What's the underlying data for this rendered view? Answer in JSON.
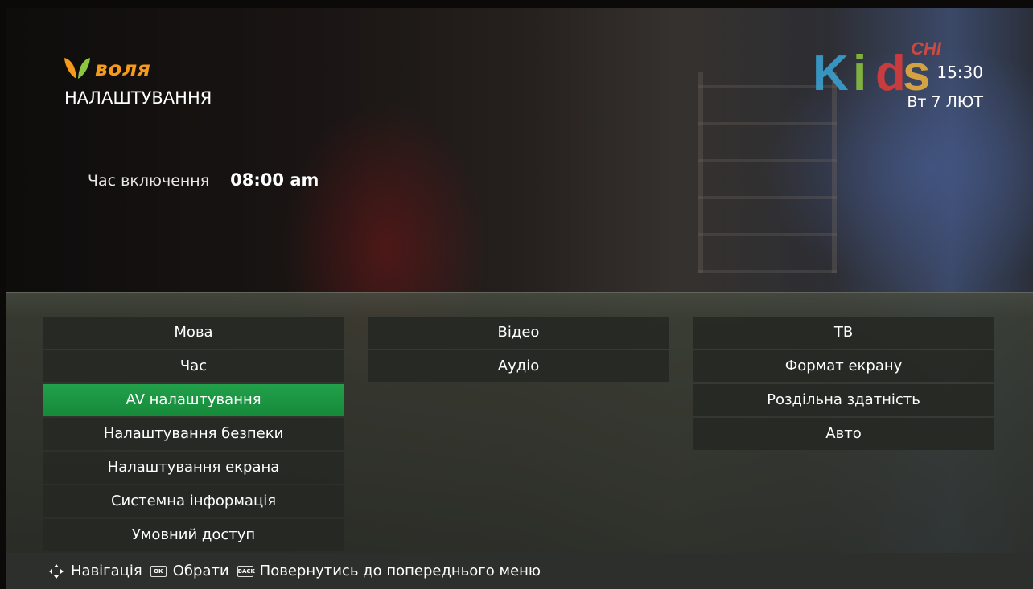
{
  "header": {
    "brand": "воля",
    "title": "НАЛАШТУВАННЯ",
    "time": "15:30",
    "date": "Вт 7 ЛЮТ"
  },
  "channel_logo": {
    "letters": [
      "K",
      "i",
      "d",
      "s"
    ],
    "badge": "СНІ",
    "colors": [
      "#3aa6d8",
      "#8dc63f",
      "#e23b3b",
      "#f0b33c"
    ]
  },
  "detail": {
    "label": "Час включення",
    "value": "08:00 am"
  },
  "menu": {
    "column1": [
      "Мова",
      "Час",
      "AV налаштування",
      "Налаштування безпеки",
      "Налаштування екрана",
      "Системна інформація",
      "Умовний доступ"
    ],
    "column2": [
      "Відео",
      "Аудіо"
    ],
    "column3": [
      "ТВ",
      "Формат екрану",
      "Роздільна здатність",
      "Авто"
    ],
    "selected": "AV налаштування",
    "accent": "#1e9a45"
  },
  "footer": {
    "nav": "Навігація",
    "ok_key": "OK",
    "ok": "Обрати",
    "back_key": "BACK",
    "back": "Повернутись до попереднього меню"
  },
  "icons": [
    "brand-leaf-icon",
    "dpad-nav-icon",
    "ok-key-icon",
    "back-key-icon"
  ]
}
